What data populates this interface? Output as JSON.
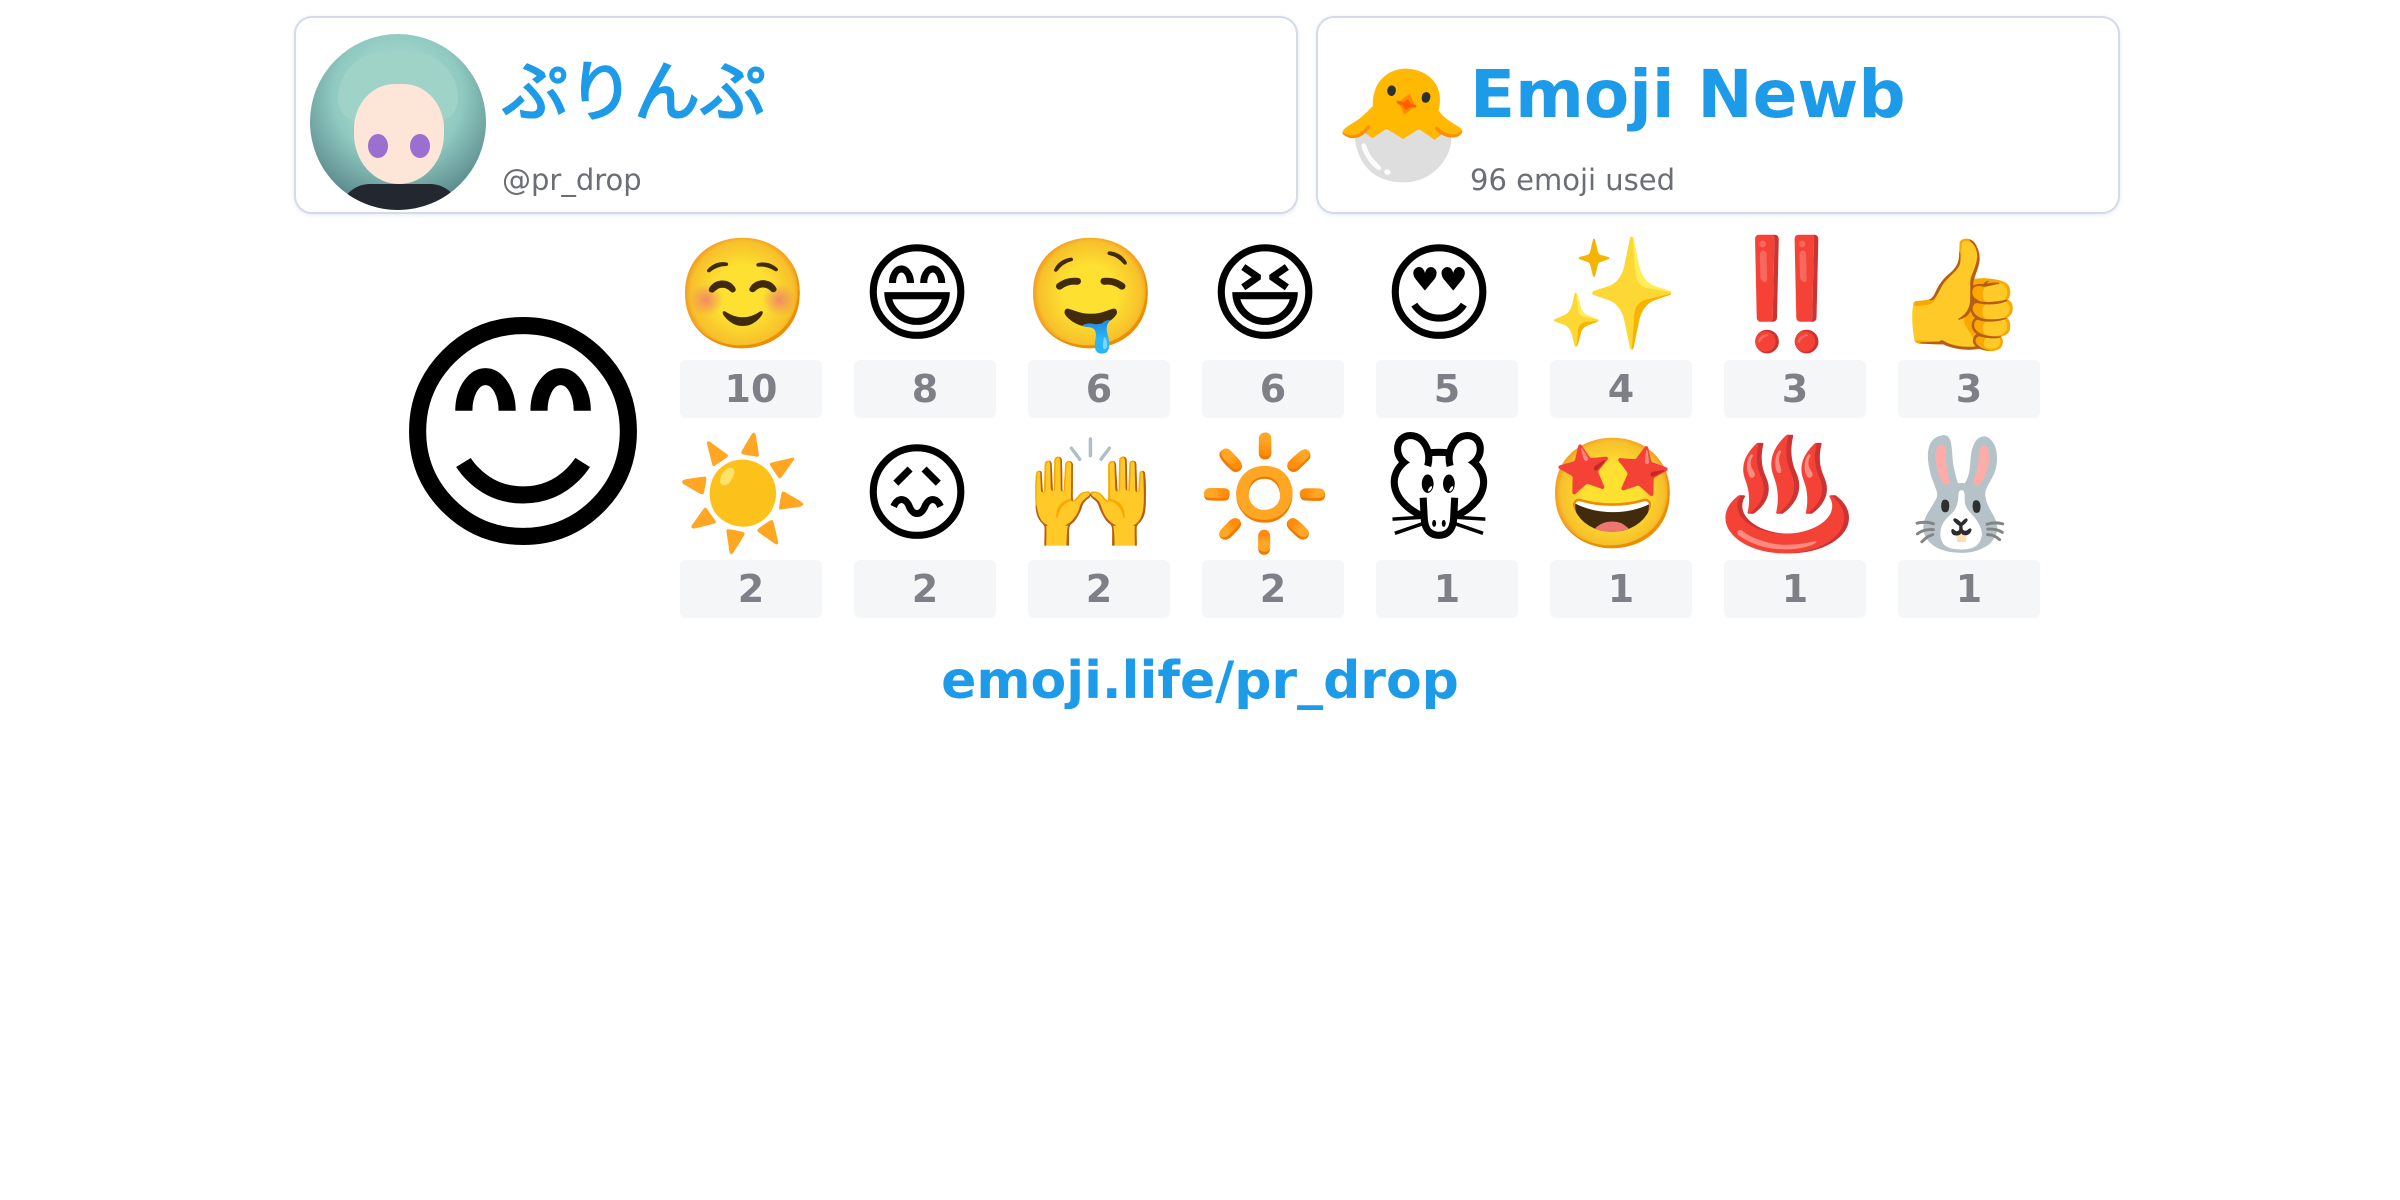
{
  "user": {
    "display_name": "ぷりんぷ",
    "handle": "@pr_drop",
    "avatar_icon": "anime-girl-avatar"
  },
  "rank": {
    "icon": "🐣",
    "title": "Emoji Newb",
    "subtitle": "96 emoji used"
  },
  "top_emoji": "😊",
  "emoji_stats": [
    {
      "emoji": "☺️",
      "count": "10"
    },
    {
      "emoji": "😄",
      "count": "8"
    },
    {
      "emoji": "🤤",
      "count": "6"
    },
    {
      "emoji": "😆",
      "count": "6"
    },
    {
      "emoji": "😍",
      "count": "5"
    },
    {
      "emoji": "✨",
      "count": "4"
    },
    {
      "emoji": "‼️",
      "count": "3"
    },
    {
      "emoji": "👍",
      "count": "3"
    },
    {
      "emoji": "☀️",
      "count": "2"
    },
    {
      "emoji": "😖",
      "count": "2"
    },
    {
      "emoji": "🙌",
      "count": "2"
    },
    {
      "emoji": "🔆",
      "count": "2"
    },
    {
      "emoji": "🐭",
      "count": "1"
    },
    {
      "emoji": "🤩",
      "count": "1"
    },
    {
      "emoji": "♨️",
      "count": "1"
    },
    {
      "emoji": "🐰",
      "count": "1"
    }
  ],
  "footer": {
    "link_text": "emoji.life/pr_drop"
  },
  "colors": {
    "accent": "#1d9be8",
    "muted_text": "#6b6f75",
    "count_text": "#7d8187",
    "count_bg": "#f5f6f8",
    "card_border": "#d3dbe8"
  }
}
